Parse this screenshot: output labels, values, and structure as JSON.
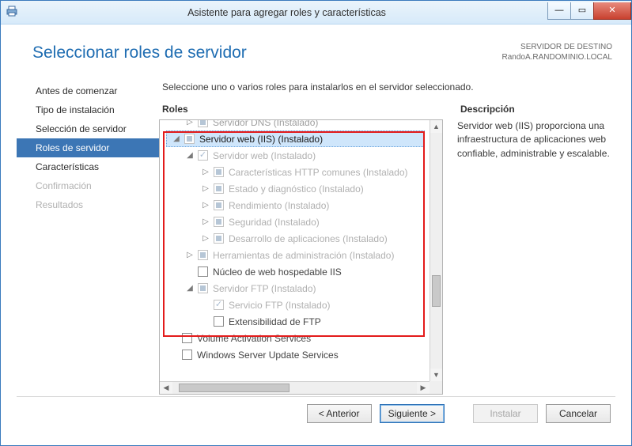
{
  "titlebar": {
    "title": "Asistente para agregar roles y características"
  },
  "page": {
    "heading": "Seleccionar roles de servidor"
  },
  "destination": {
    "label": "SERVIDOR DE DESTINO",
    "server": "RandoA.RANDOMINIO.LOCAL"
  },
  "sidebar": {
    "steps": [
      {
        "label": "Antes de comenzar"
      },
      {
        "label": "Tipo de instalación"
      },
      {
        "label": "Selección de servidor"
      },
      {
        "label": "Roles de servidor"
      },
      {
        "label": "Características"
      },
      {
        "label": "Confirmación"
      },
      {
        "label": "Resultados"
      }
    ]
  },
  "main": {
    "instruction": "Seleccione uno o varios roles para instalarlos en el servidor seleccionado.",
    "roles_header": "Roles",
    "desc_header": "Descripción",
    "description": "Servidor web (IIS) proporciona una infraestructura de aplicaciones web confiable, administrable y escalable.",
    "tree": {
      "cut_row": "Servidor DNS (Instalado)",
      "iis": "Servidor web (IIS) (Instalado)",
      "web": "Servidor web (Instalado)",
      "http": "Características HTTP comunes (Instalado)",
      "health": "Estado y diagnóstico (Instalado)",
      "perf": "Rendimiento (Instalado)",
      "sec": "Seguridad (Instalado)",
      "appdev": "Desarrollo de aplicaciones (Instalado)",
      "mgmt": "Herramientas de administración (Instalado)",
      "hostable": "Núcleo de web hospedable IIS",
      "ftp": "Servidor FTP (Instalado)",
      "ftpsvc": "Servicio FTP (Instalado)",
      "ftpex": "Extensibilidad de FTP",
      "vas": "Volume Activation Services",
      "wsus": "Windows Server Update Services"
    }
  },
  "footer": {
    "back": "< Anterior",
    "next": "Siguiente >",
    "install": "Instalar",
    "cancel": "Cancelar"
  }
}
